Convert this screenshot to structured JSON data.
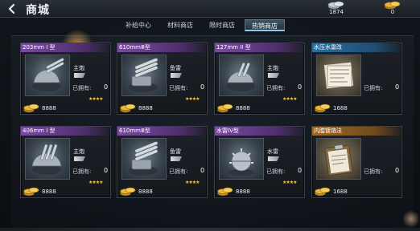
{
  "header": {
    "title": "商城",
    "silver_count": "1874",
    "gold_count": "0"
  },
  "tabs": [
    {
      "label": "补给中心",
      "active": false
    },
    {
      "label": "材料商店",
      "active": false
    },
    {
      "label": "限时商店",
      "active": false
    },
    {
      "label": "热销商店",
      "active": true
    }
  ],
  "common": {
    "owned_label": "已拥有:"
  },
  "items": [
    {
      "name": "203mm I 型",
      "kind": "主炮",
      "owned": "0",
      "price": "8888",
      "stars": "★★★★",
      "rarity": "purple",
      "icon": "turret-icon"
    },
    {
      "name": "610mmⅢ型",
      "kind": "鱼雷",
      "owned": "0",
      "price": "8888",
      "stars": "★★★★",
      "rarity": "purple",
      "icon": "torpedo-launcher-icon"
    },
    {
      "name": "127mm II 型",
      "kind": "主炮",
      "owned": "0",
      "price": "8888",
      "stars": "★★★★",
      "rarity": "purple",
      "icon": "turret-icon"
    },
    {
      "name": "水压水雷改",
      "kind": "",
      "owned": "0",
      "price": "1688",
      "stars": "",
      "rarity": "blue",
      "icon": "blueprint-icon"
    },
    {
      "name": "406mm I 型",
      "kind": "主炮",
      "owned": "0",
      "price": "8888",
      "stars": "★★★★",
      "rarity": "purple",
      "icon": "turret-icon"
    },
    {
      "name": "610mmⅢ型",
      "kind": "鱼雷",
      "owned": "0",
      "price": "8888",
      "stars": "★★★★",
      "rarity": "purple",
      "icon": "torpedo-launcher-icon"
    },
    {
      "name": "水雷IV型",
      "kind": "水雷",
      "owned": "0",
      "price": "8888",
      "stars": "★★★★",
      "rarity": "purple",
      "icon": "sea-mine-icon"
    },
    {
      "name": "内膛镀铬法",
      "kind": "",
      "owned": "0",
      "price": "1688",
      "stars": "",
      "rarity": "orange",
      "icon": "clipboard-icon"
    }
  ],
  "colors": {
    "purple": "#7c4aa6",
    "blue": "#2a6ea0",
    "orange": "#a06a26",
    "active_tab": "#8ec8ee",
    "star": "#f3c748"
  }
}
